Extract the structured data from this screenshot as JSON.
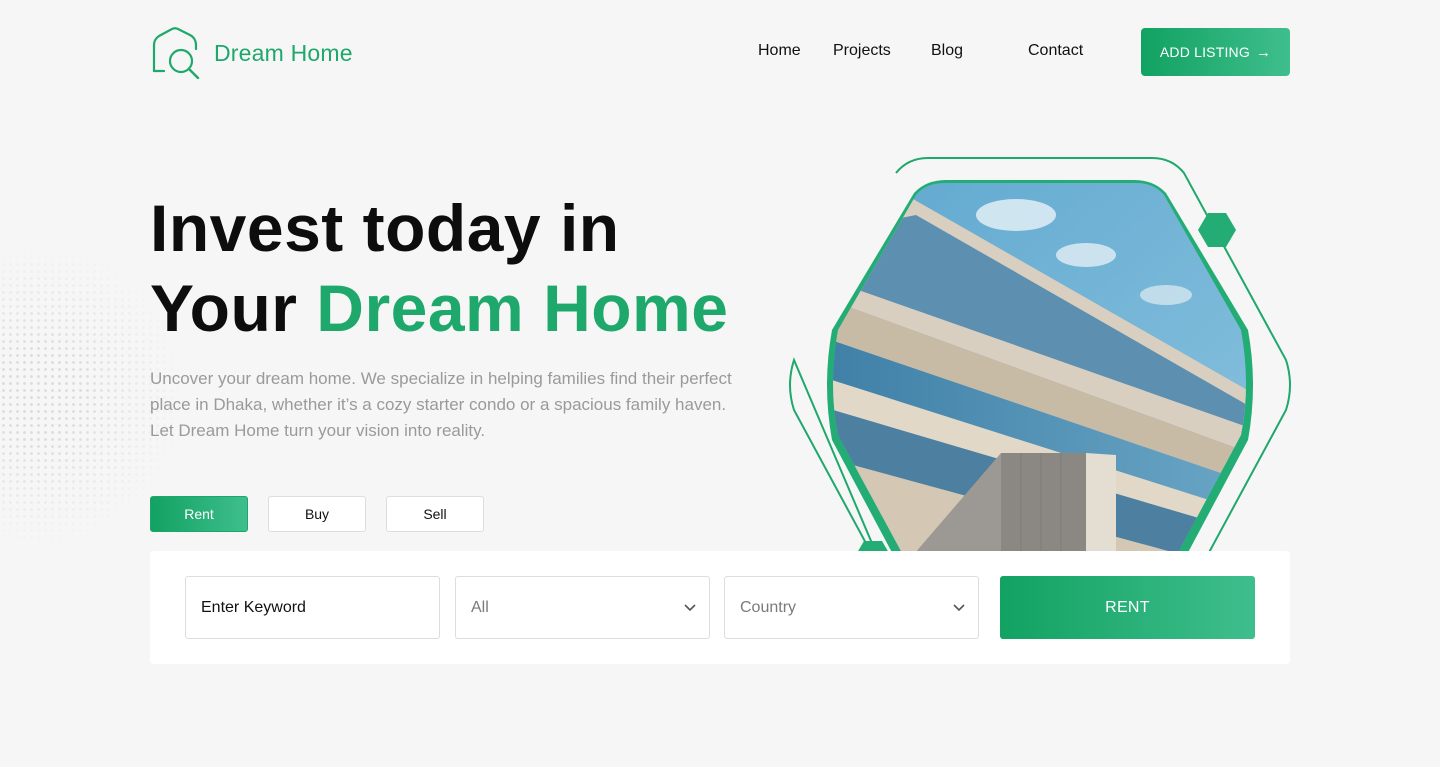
{
  "brand": {
    "name": "Dream Home",
    "logo_icon": "house-search-icon",
    "accent_color": "#1fa86b"
  },
  "nav": {
    "items": [
      "Home",
      "Projects",
      "Blog",
      "Contact"
    ]
  },
  "header": {
    "cta_label": "ADD LISTING",
    "cta_icon": "arrow-right-icon",
    "cta_arrow": "→"
  },
  "hero": {
    "title_line1": "Invest today in",
    "title_line2_prefix": "Your",
    "title_line2_highlight": "Dream Home",
    "description": "Uncover your dream home. We specialize in helping families find their perfect place in Dhaka, whether it’s a cozy starter condo or a spacious family haven. Let Dream Home turn your vision into reality."
  },
  "tabs": [
    {
      "label": "Rent",
      "active": true
    },
    {
      "label": "Buy",
      "active": false
    },
    {
      "label": "Sell",
      "active": false
    }
  ],
  "search": {
    "keyword_value": "Enter Keyword",
    "type_selected": "All",
    "country_selected": "Country",
    "submit_label": "RENT"
  }
}
